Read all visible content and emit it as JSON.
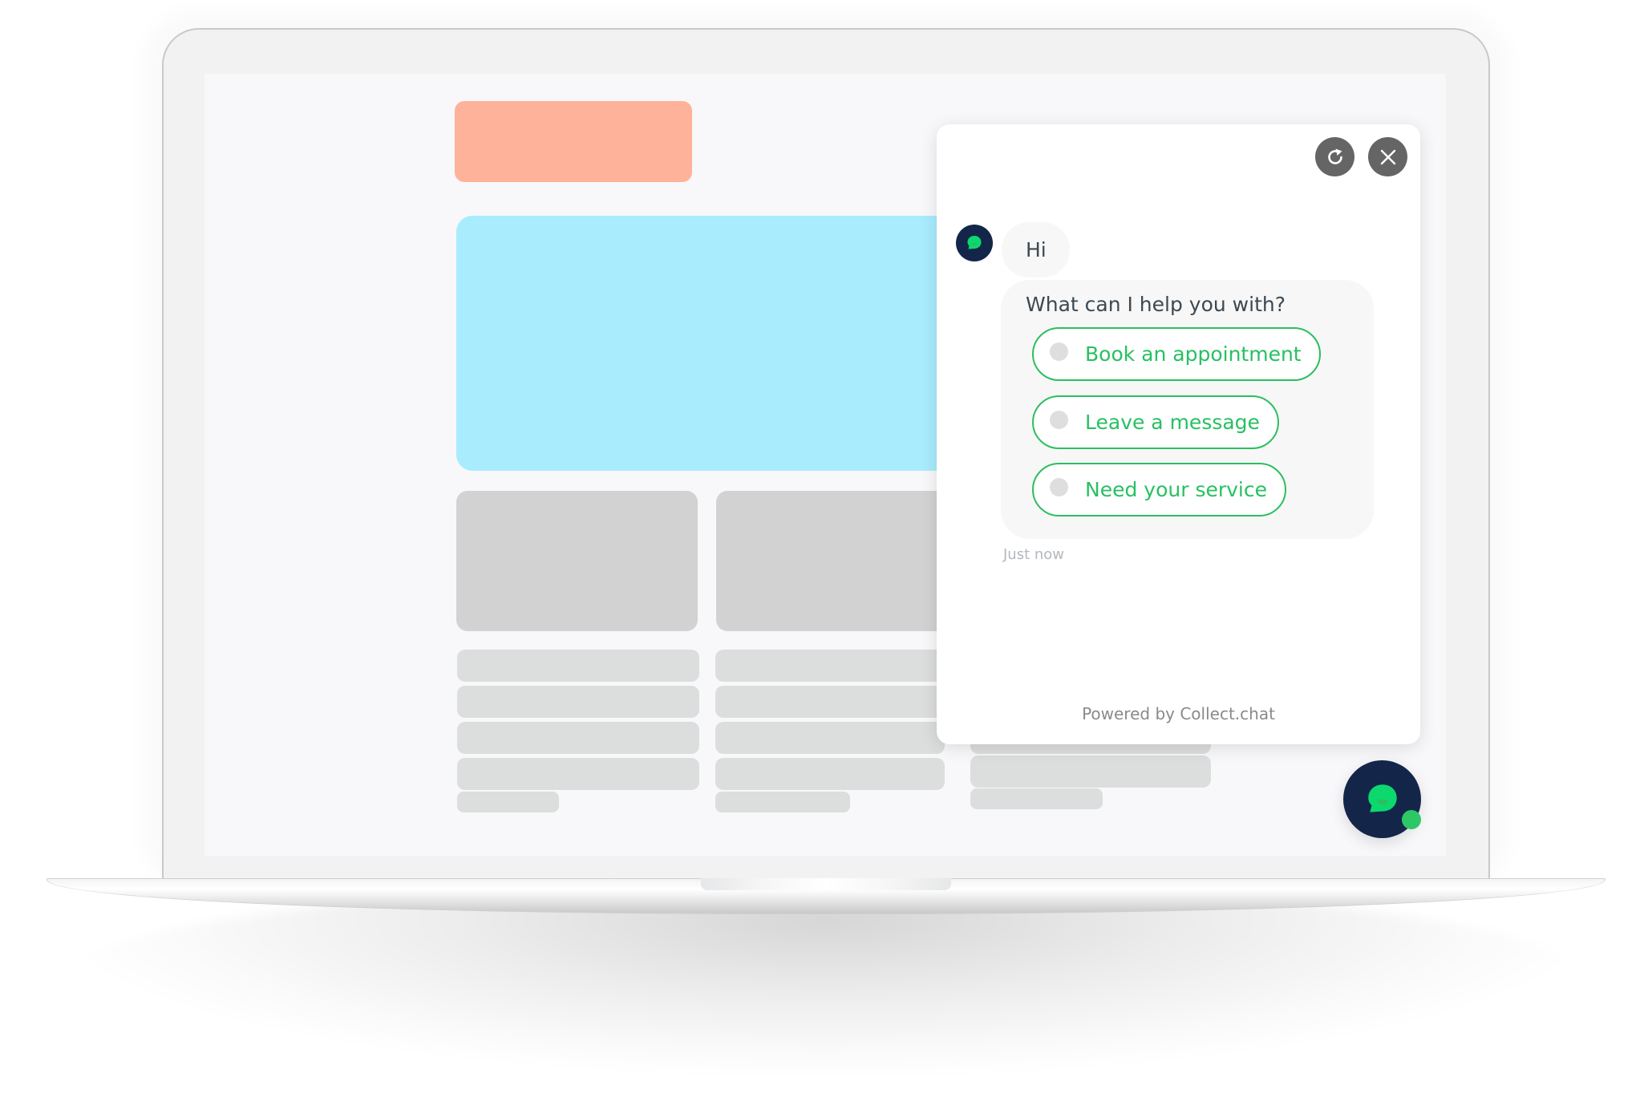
{
  "colors": {
    "brand_green": "#27c062",
    "navy": "#13264a",
    "icon_button_gray": "#656565",
    "placeholder_orange": "#ffb29a",
    "placeholder_blue": "#a8ecfd",
    "placeholder_gray": "#d2d2d2"
  },
  "chat": {
    "header": {
      "refresh_icon": "refresh-icon",
      "close_icon": "close-icon"
    },
    "bot_avatar_icon": "chat-bubble-icon",
    "messages": [
      {
        "text": "Hi"
      },
      {
        "text": "What can I help you with?"
      }
    ],
    "options": [
      {
        "label": "Book an appointment"
      },
      {
        "label": "Leave a message"
      },
      {
        "label": "Need your service"
      }
    ],
    "timestamp": "Just now",
    "footer": "Powered by Collect.chat"
  },
  "launcher": {
    "icon": "chat-bubble-icon",
    "status": "online"
  }
}
